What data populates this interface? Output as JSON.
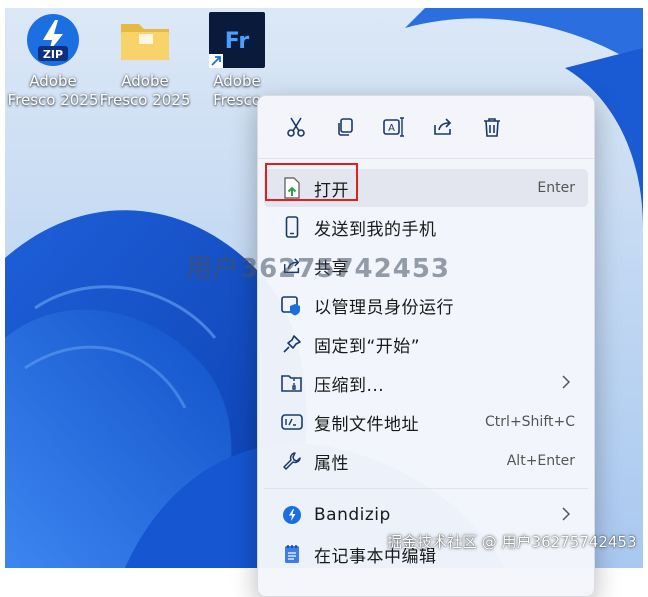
{
  "desktop": {
    "icons": [
      {
        "name": "Adobe\nFresco 2025",
        "badge": "ZIP"
      },
      {
        "name": "Adobe\nFresco 2025"
      },
      {
        "name": "Adobe\nFresco",
        "badge": "Fr"
      }
    ]
  },
  "context_menu": {
    "quick_actions": [
      "cut-icon",
      "copy-icon",
      "rename-icon",
      "share-icon",
      "delete-icon"
    ],
    "items": [
      {
        "label": "打开",
        "shortcut": "Enter"
      },
      {
        "label": "发送到我的手机"
      },
      {
        "label": "共享"
      },
      {
        "label": "以管理员身份运行"
      },
      {
        "label": "固定到“开始”"
      },
      {
        "label": "压缩到..."
      },
      {
        "label": "复制文件地址",
        "shortcut": "Ctrl+Shift+C"
      },
      {
        "label": "属性",
        "shortcut": "Alt+Enter"
      },
      {
        "label": "Bandizip"
      },
      {
        "label": "在记事本中编辑"
      }
    ]
  },
  "watermarks": {
    "center": "用户3627574245​3",
    "footer": "掘金技术社区 @ 用户3627574245​3"
  },
  "colors": {
    "accent": "#1a6fe0",
    "highlight_border": "#e02020",
    "wallpaper": "#1e5fd8"
  }
}
